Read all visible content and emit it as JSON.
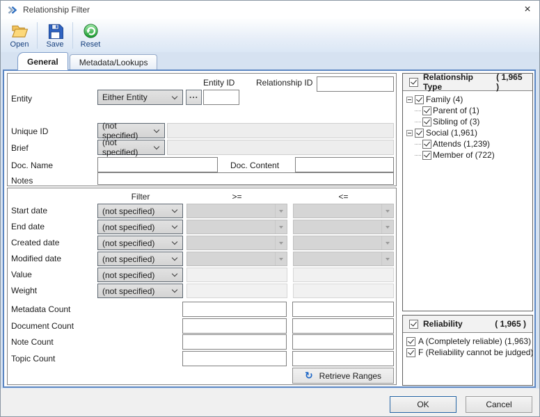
{
  "window": {
    "title": "Relationship Filter"
  },
  "toolbar": {
    "open": "Open",
    "save": "Save",
    "reset": "Reset"
  },
  "tabs": {
    "general": "General",
    "metadata": "Metadata/Lookups"
  },
  "form": {
    "entity_label": "Entity",
    "entity_value": "Either Entity",
    "browse_label": "...",
    "entity_id_label": "Entity ID",
    "entity_id_value": "",
    "relationship_id_label": "Relationship ID",
    "relationship_id_value": "",
    "unique_id_label": "Unique ID",
    "unique_id_filter": "(not specified)",
    "brief_label": "Brief",
    "brief_filter": "(not specified)",
    "doc_name_label": "Doc. Name",
    "doc_name_value": "",
    "doc_content_label": "Doc. Content",
    "doc_content_value": "",
    "notes_label": "Notes",
    "notes_value": ""
  },
  "filter_table": {
    "header_filter": "Filter",
    "header_ge": ">=",
    "header_le": "<=",
    "rows": [
      {
        "label": "Start date",
        "filter": "(not specified)"
      },
      {
        "label": "End date",
        "filter": "(not specified)"
      },
      {
        "label": "Created date",
        "filter": "(not specified)"
      },
      {
        "label": "Modified date",
        "filter": "(not specified)"
      },
      {
        "label": "Value",
        "filter": "(not specified)"
      },
      {
        "label": "Weight",
        "filter": "(not specified)"
      }
    ],
    "count_rows": [
      {
        "label": "Metadata Count",
        "min": "",
        "max": ""
      },
      {
        "label": "Document Count",
        "min": "",
        "max": ""
      },
      {
        "label": "Note Count",
        "min": "",
        "max": ""
      },
      {
        "label": "Topic Count",
        "min": "",
        "max": ""
      }
    ],
    "retrieve_button": "Retrieve Ranges"
  },
  "relationship_type": {
    "title": "Relationship Type",
    "count": "( 1,965 )",
    "items": [
      {
        "label": "Family (4)"
      },
      {
        "label": "Parent of (1)"
      },
      {
        "label": "Sibling of (3)"
      },
      {
        "label": "Social (1,961)"
      },
      {
        "label": "Attends (1,239)"
      },
      {
        "label": "Member of (722)"
      }
    ]
  },
  "reliability": {
    "title": "Reliability",
    "count": "( 1,965 )",
    "items": [
      {
        "label": "A (Completely reliable) (1,963)"
      },
      {
        "label": "F (Reliability cannot be judged) ("
      }
    ]
  },
  "footer": {
    "ok": "OK",
    "cancel": "Cancel"
  },
  "colors": {
    "accent": "#5b86c2",
    "toolbar_label": "#17407e",
    "save_blue": "#2f63c1",
    "folder_gold": "#f3c55f",
    "reset_green": "#2aa12e"
  }
}
